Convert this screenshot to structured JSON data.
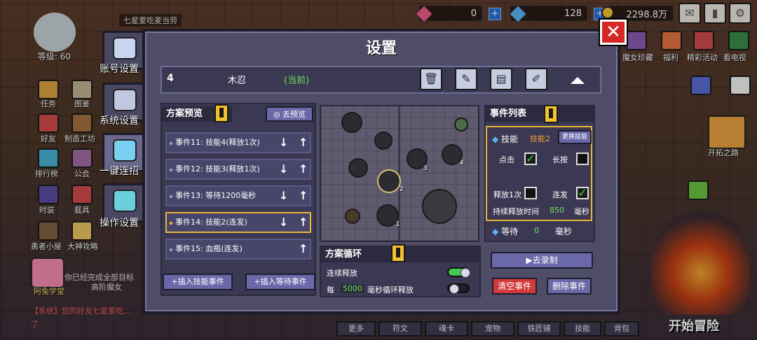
{
  "top": {
    "banner_text": "七星爱吃麦当劳",
    "resource_1": "0",
    "resource_2": "128",
    "resource_3": "2298.8万",
    "player_level": "等级: 60"
  },
  "right_menu": {
    "items": [
      "魔女珍藏",
      "福利",
      "精彩活动",
      "看电视"
    ],
    "expedition": "开拓之路",
    "start_adventure": "开始冒险"
  },
  "left_menu": {
    "items": [
      "任务",
      "图鉴",
      "好友",
      "制造工坊",
      "排行榜",
      "公会",
      "时装",
      "载具",
      "勇者小屋",
      "大神攻略"
    ],
    "school": "阿兔学堂",
    "notice": "你已经完成全部目标",
    "notice2": "高阶魔女",
    "chat": "【系统】您的好友七星爱吃...",
    "chat2": "了"
  },
  "settings_tabs": {
    "account": "账号设置",
    "system": "系统设置",
    "combo": "一键连招",
    "controls": "操作设置"
  },
  "dialog": {
    "title": "设置",
    "plan_number": "4",
    "plan_name": "木忍",
    "plan_current": "(当前)"
  },
  "preview": {
    "header": "方案预览",
    "go_preview": "去预览",
    "events": [
      {
        "label": "事件11: 技能4(释放1次)"
      },
      {
        "label": "事件12: 技能3(释放1次)"
      },
      {
        "label": "事件13: 等待1200毫秒"
      },
      {
        "label": "事件14: 技能2(连发)"
      },
      {
        "label": "事件15: 血瓶(连发)"
      }
    ],
    "insert_skill": "插入技能事件",
    "insert_wait": "插入等待事件"
  },
  "map_nodes": [
    "2",
    "3",
    "4",
    "1"
  ],
  "loop": {
    "header": "方案循环",
    "continuous": "连续释放",
    "every": "每",
    "ms_value": "5000",
    "ms_suffix": "毫秒循环释放",
    "continuous_on": true,
    "loop_on": false
  },
  "event_list": {
    "header": "事件列表",
    "skill_label": "技能",
    "skill_value": "技能2",
    "change_skill": "更换技能",
    "click": "点击",
    "long_press": "长按",
    "release_once": "释放1次",
    "burst": "连发",
    "duration": "持续释放时间",
    "duration_value": "850",
    "duration_unit": "毫秒",
    "wait": "等待",
    "wait_value": "0",
    "wait_unit": "毫秒",
    "record": "去录制",
    "clear": "清空事件",
    "delete": "删除事件"
  },
  "bottom_tabs": [
    "更多",
    "符文",
    "魂卡",
    "宠物",
    "铁匠铺",
    "技能",
    "背包"
  ],
  "colors": {
    "dialog_bg": "#4f4c68",
    "accent_yellow": "#f2c12e",
    "close_red": "#d62626",
    "green_value": "#6ee05e",
    "skill_orange": "#f0a030"
  }
}
